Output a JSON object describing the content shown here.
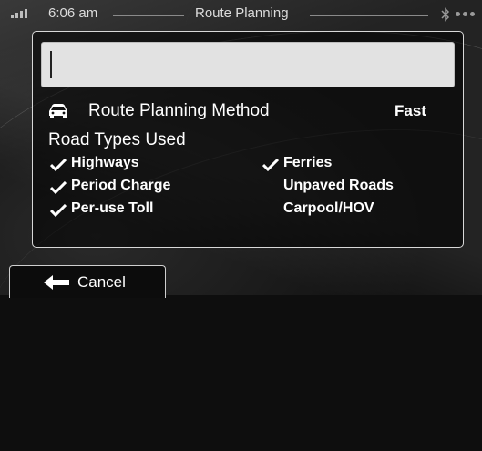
{
  "status_bar": {
    "time": "6:06 am",
    "title": "Route Planning",
    "signal_icon": "signal-bars-icon",
    "bluetooth_icon": "bluetooth-icon"
  },
  "search": {
    "value": "",
    "placeholder": ""
  },
  "route_method": {
    "icon": "car-icon",
    "label": "Route Planning Method",
    "value": "Fast"
  },
  "road_types": {
    "heading": "Road Types Used",
    "options": [
      {
        "label": "Highways",
        "checked": true
      },
      {
        "label": "Period Charge",
        "checked": true
      },
      {
        "label": "Per-use Toll",
        "checked": true
      },
      {
        "label": "Ferries",
        "checked": true
      },
      {
        "label": "Unpaved Roads",
        "checked": false
      },
      {
        "label": "Carpool/HOV",
        "checked": false
      }
    ]
  },
  "footer": {
    "cancel_label": "Cancel",
    "cancel_icon": "arrow-left-icon"
  }
}
